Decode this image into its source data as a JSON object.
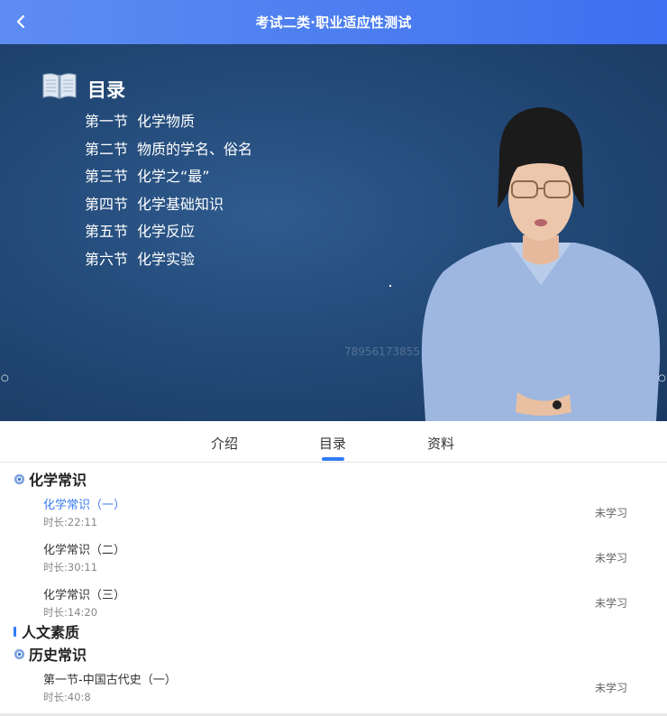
{
  "header": {
    "title": "考试二类·职业适应性测试"
  },
  "video": {
    "slide_title": "目录",
    "toc": [
      {
        "sec": "第一节",
        "name": "化学物质"
      },
      {
        "sec": "第二节",
        "name": "物质的学名、俗名"
      },
      {
        "sec": "第三节",
        "name": "化学之“最”"
      },
      {
        "sec": "第四节",
        "name": "化学基础知识"
      },
      {
        "sec": "第五节",
        "name": "化学反应"
      },
      {
        "sec": "第六节",
        "name": "化学实验"
      }
    ],
    "watermark": "78956173855"
  },
  "tabs": [
    {
      "label": "介绍"
    },
    {
      "label": "目录"
    },
    {
      "label": "资料"
    }
  ],
  "catalog": {
    "section1": "化学常识",
    "lessons1": [
      {
        "name": "化学常识（一）",
        "duration": "时长:22:11",
        "status": "未学习"
      },
      {
        "name": "化学常识（二）",
        "duration": "时长:30:11",
        "status": "未学习"
      },
      {
        "name": "化学常识（三）",
        "duration": "时长:14:20",
        "status": "未学习"
      }
    ],
    "chapter2": "人文素质",
    "section2": "历史常识",
    "lessons2": [
      {
        "name": "第一节-中国古代史（一）",
        "duration": "时长:40:8",
        "status": "未学习"
      }
    ]
  },
  "colors": {
    "accent": "#2f7cf6",
    "header_blue": "#4a7cf0",
    "video_bg": "#234a78"
  }
}
